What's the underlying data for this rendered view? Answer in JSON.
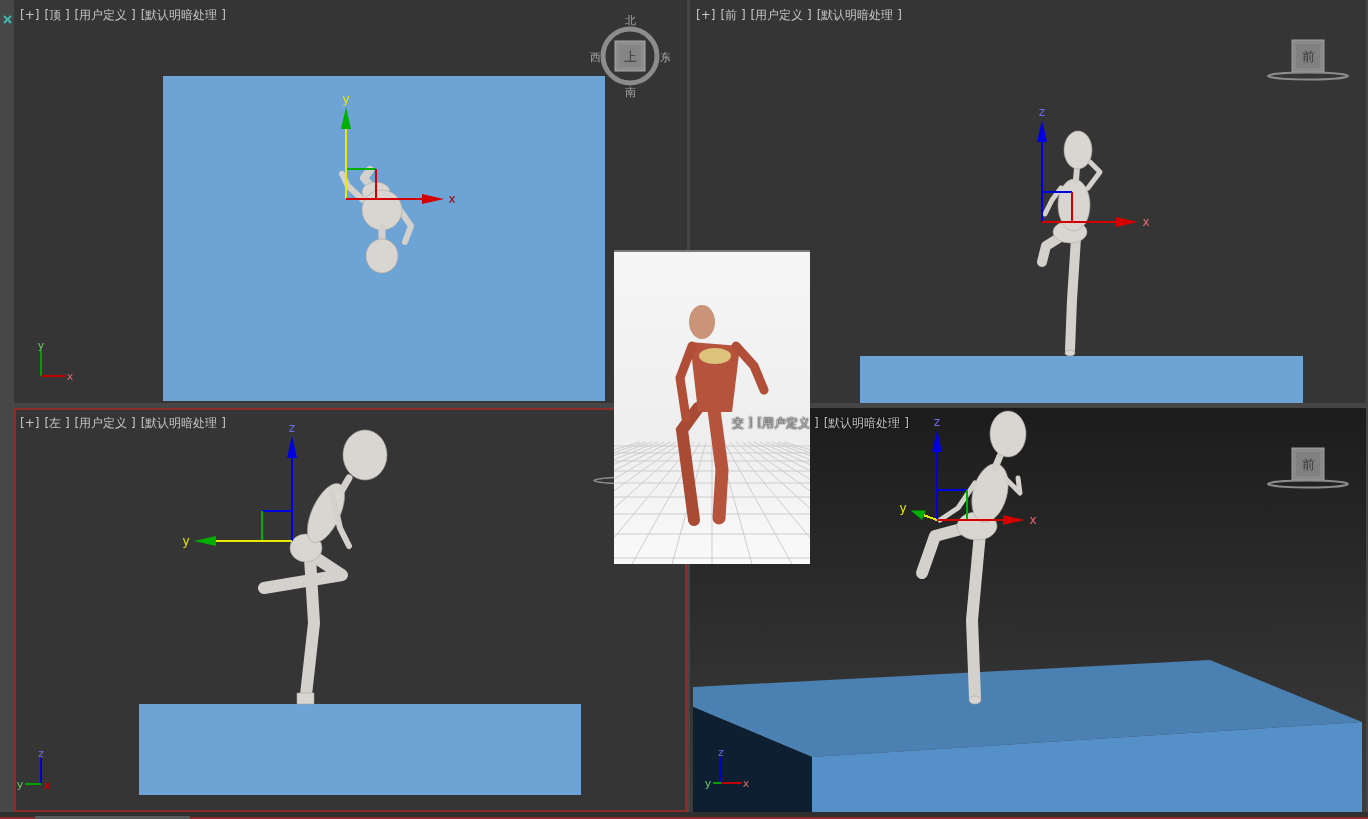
{
  "viewports": [
    {
      "kind": "top",
      "selected": false,
      "labels": [
        "[+]",
        "[顶 ]",
        "[用户定义 ]",
        "[默认明暗处理 ]"
      ],
      "viewcube": {
        "kind": "compass",
        "face": "上",
        "compass": {
          "north": "北",
          "west": "西",
          "east": "东",
          "south": "南"
        }
      },
      "gizmo": [
        {
          "label": "y",
          "color": "#00b000",
          "active": true
        },
        {
          "label": "x",
          "color": "#d40000",
          "active": false
        }
      ],
      "tripod": [
        {
          "label": "y",
          "color": "#00a000"
        },
        {
          "label": "x",
          "color": "#c00000"
        }
      ]
    },
    {
      "kind": "front",
      "selected": false,
      "labels": [
        "[+]",
        "[前 ]",
        "[用户定义 ]",
        "[默认明暗处理 ]"
      ],
      "viewcube": {
        "kind": "cube",
        "face": "前"
      },
      "gizmo": [
        {
          "label": "z",
          "color": "#0000e0",
          "active": false
        },
        {
          "label": "x",
          "color": "#d40000",
          "active": false
        }
      ]
    },
    {
      "kind": "left",
      "selected": true,
      "labels": [
        "[+]",
        "[左 ]",
        "[用户定义 ]",
        "[默认明暗处理 ]"
      ],
      "viewcube": {
        "kind": "ring"
      },
      "gizmo": [
        {
          "label": "z",
          "color": "#0000e0",
          "active": false
        },
        {
          "label": "y",
          "color": "#00b000",
          "active": true
        }
      ],
      "tripod": [
        {
          "label": "z",
          "color": "#0000d0"
        },
        {
          "label": "y",
          "color": "#00a000"
        },
        {
          "label": "x",
          "color": "#c00000"
        }
      ]
    },
    {
      "kind": "user",
      "selected": false,
      "labels": [
        "交 ]",
        "[用户定义 ]",
        "[默认明暗处理 ]"
      ],
      "viewcube": {
        "kind": "cube",
        "face": "前"
      },
      "gizmo": [
        {
          "label": "z",
          "color": "#0000e0",
          "active": false
        },
        {
          "label": "y",
          "color": "#00b000",
          "active": true
        },
        {
          "label": "x",
          "color": "#d40000",
          "active": false
        }
      ],
      "tripod": [
        {
          "label": "z",
          "color": "#0000d0"
        },
        {
          "label": "y",
          "color": "#00a000"
        },
        {
          "label": "x",
          "color": "#c00000"
        }
      ]
    }
  ]
}
